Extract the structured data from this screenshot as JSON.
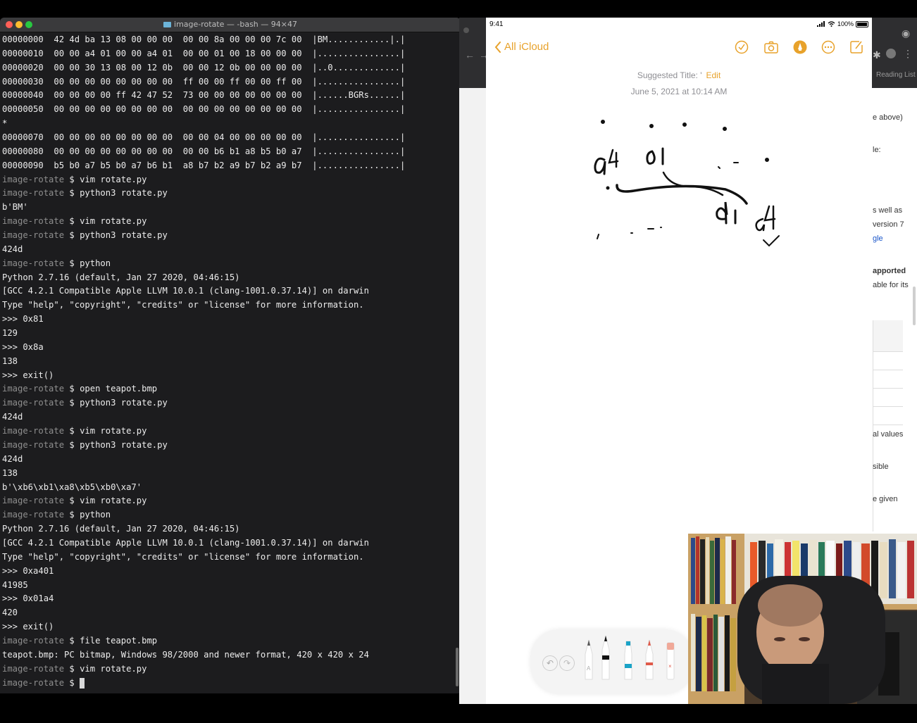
{
  "terminal": {
    "title": "image-rotate — -bash — 94×47",
    "lines": [
      {
        "text": "00000000  42 4d ba 13 08 00 00 00  00 00 8a 00 00 00 7c 00  |BM............|.|"
      },
      {
        "text": "00000010  00 00 a4 01 00 00 a4 01  00 00 01 00 18 00 00 00  |................|"
      },
      {
        "text": "00000020  00 00 30 13 08 00 12 0b  00 00 12 0b 00 00 00 00  |..0.............|"
      },
      {
        "text": "00000030  00 00 00 00 00 00 00 00  ff 00 00 ff 00 00 ff 00  |................|"
      },
      {
        "text": "00000040  00 00 00 00 ff 42 47 52  73 00 00 00 00 00 00 00  |......BGRs......|"
      },
      {
        "text": "00000050  00 00 00 00 00 00 00 00  00 00 00 00 00 00 00 00  |................|"
      },
      {
        "text": "*"
      },
      {
        "text": "00000070  00 00 00 00 00 00 00 00  00 00 04 00 00 00 00 00  |................|"
      },
      {
        "text": "00000080  00 00 00 00 00 00 00 00  00 00 b6 b1 a8 b5 b0 a7  |................|"
      },
      {
        "text": "00000090  b5 b0 a7 b5 b0 a7 b6 b1  a8 b7 b2 a9 b7 b2 a9 b7  |................|"
      },
      {
        "prompt": "image-rotate",
        "text": " $ vim rotate.py"
      },
      {
        "prompt": "image-rotate",
        "text": " $ python3 rotate.py"
      },
      {
        "text": "b'BM'"
      },
      {
        "prompt": "image-rotate",
        "text": " $ vim rotate.py"
      },
      {
        "prompt": "image-rotate",
        "text": " $ python3 rotate.py"
      },
      {
        "text": "424d"
      },
      {
        "prompt": "image-rotate",
        "text": " $ python"
      },
      {
        "text": "Python 2.7.16 (default, Jan 27 2020, 04:46:15)"
      },
      {
        "text": "[GCC 4.2.1 Compatible Apple LLVM 10.0.1 (clang-1001.0.37.14)] on darwin"
      },
      {
        "text": "Type \"help\", \"copyright\", \"credits\" or \"license\" for more information."
      },
      {
        "text": ">>> 0x81"
      },
      {
        "text": "129"
      },
      {
        "text": ">>> 0x8a"
      },
      {
        "text": "138"
      },
      {
        "text": ">>> exit()"
      },
      {
        "prompt": "image-rotate",
        "text": " $ open teapot.bmp"
      },
      {
        "prompt": "image-rotate",
        "text": " $ python3 rotate.py"
      },
      {
        "text": "424d"
      },
      {
        "prompt": "image-rotate",
        "text": " $ vim rotate.py"
      },
      {
        "prompt": "image-rotate",
        "text": " $ python3 rotate.py"
      },
      {
        "text": "424d"
      },
      {
        "text": "138"
      },
      {
        "text": "b'\\xb6\\xb1\\xa8\\xb5\\xb0\\xa7'"
      },
      {
        "prompt": "image-rotate",
        "text": " $ vim rotate.py"
      },
      {
        "prompt": "image-rotate",
        "text": " $ python"
      },
      {
        "text": "Python 2.7.16 (default, Jan 27 2020, 04:46:15)"
      },
      {
        "text": "[GCC 4.2.1 Compatible Apple LLVM 10.0.1 (clang-1001.0.37.14)] on darwin"
      },
      {
        "text": "Type \"help\", \"copyright\", \"credits\" or \"license\" for more information."
      },
      {
        "text": ">>> 0xa401"
      },
      {
        "text": "41985"
      },
      {
        "text": ">>> 0x01a4"
      },
      {
        "text": "420"
      },
      {
        "text": ">>> exit()"
      },
      {
        "prompt": "image-rotate",
        "text": " $ file teapot.bmp"
      },
      {
        "text": "teapot.bmp: PC bitmap, Windows 98/2000 and newer format, 420 x 420 x 24"
      },
      {
        "prompt": "image-rotate",
        "text": " $ vim rotate.py"
      },
      {
        "prompt": "image-rotate",
        "text": " $ ",
        "cursor": true
      }
    ]
  },
  "browser": {
    "reading_list": "Reading List",
    "fragments": [
      "e above)",
      "le:",
      "s well as",
      "version 7",
      "gle",
      "apported",
      "able for its",
      "al values",
      "sible",
      "e given"
    ]
  },
  "ipad": {
    "time": "9:41",
    "battery": "100%",
    "back_label": "All iCloud",
    "suggested_title": "Suggested Title: '",
    "edit_label": "Edit",
    "date": "June 5, 2021 at 10:14 AM",
    "accent": "#e8a22b"
  }
}
